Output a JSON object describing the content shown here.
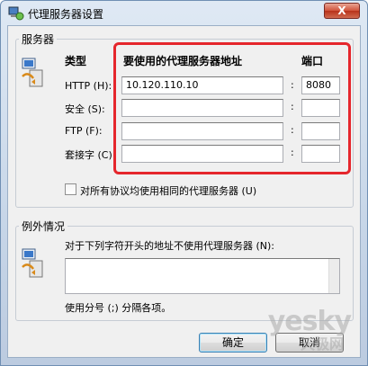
{
  "window": {
    "title": "代理服务器设置",
    "close_glyph": "X"
  },
  "servers": {
    "group_title": "服务器",
    "col_type": "类型",
    "col_address": "要使用的代理服务器地址",
    "col_port": "端口",
    "rows": [
      {
        "label": "HTTP (H):",
        "address": "10.120.110.10",
        "port": "8080"
      },
      {
        "label": "安全 (S):",
        "address": "",
        "port": ""
      },
      {
        "label": "FTP (F):",
        "address": "",
        "port": ""
      },
      {
        "label": "套接字 (C):",
        "address": "",
        "port": ""
      }
    ],
    "same_proxy_label": "对所有协议均使用相同的代理服务器 (U)"
  },
  "exceptions": {
    "group_title": "例外情况",
    "desc": "对于下列字符开头的地址不使用代理服务器 (N):",
    "value": "",
    "hint": "使用分号 (;) 分隔各项。"
  },
  "buttons": {
    "ok": "确定",
    "cancel": "取消"
  },
  "watermark": {
    "brand": "yesky",
    "sub": "天极网"
  },
  "colors": {
    "highlight": "#e5262c"
  }
}
